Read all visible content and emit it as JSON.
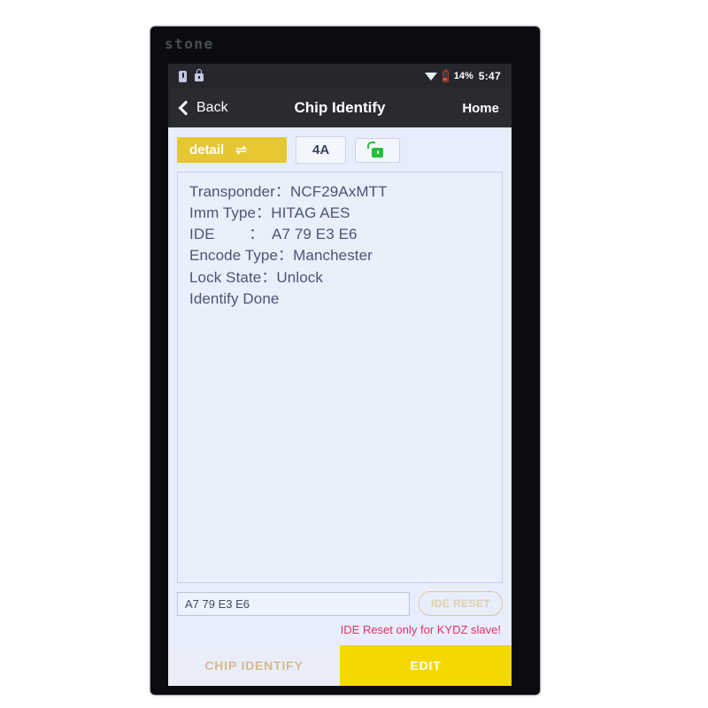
{
  "device": {
    "brand": "stone"
  },
  "status_bar": {
    "icons": [
      "sim-icon",
      "lock-icon",
      "wifi-icon",
      "battery-icon"
    ],
    "battery_percent": "14%",
    "time": "5:47"
  },
  "nav_bar": {
    "back_label": "Back",
    "title": "Chip Identify",
    "home_label": "Home"
  },
  "toolbar": {
    "detail_label": "detail",
    "swap_icon": "⇌",
    "page_label": "4A",
    "lock_icon": "unlock-icon"
  },
  "info_panel": {
    "lines": [
      "Transponder：NCF29AxMTT",
      "Imm Type：HITAG AES",
      "IDE        ：  A7 79 E3 E6",
      "Encode Type：Manchester",
      "Lock State：Unlock",
      "Identify Done"
    ]
  },
  "input_row": {
    "ide_value": "A7 79 E3 E6",
    "ide_placeholder": "",
    "reset_label": "IDE RESET"
  },
  "warning": {
    "text": "IDE Reset only for KYDZ slave!"
  },
  "tabs": [
    {
      "label": "CHIP IDENTIFY",
      "active": false
    },
    {
      "label": "EDIT",
      "active": true
    }
  ],
  "colors": {
    "accent_yellow": "#f5d800",
    "detail_yellow": "#e4c731",
    "unlock_green": "#22c03c",
    "warning_red": "#e0336b",
    "screen_bg": "#e7edfa",
    "bezel": "#0b0c10"
  }
}
